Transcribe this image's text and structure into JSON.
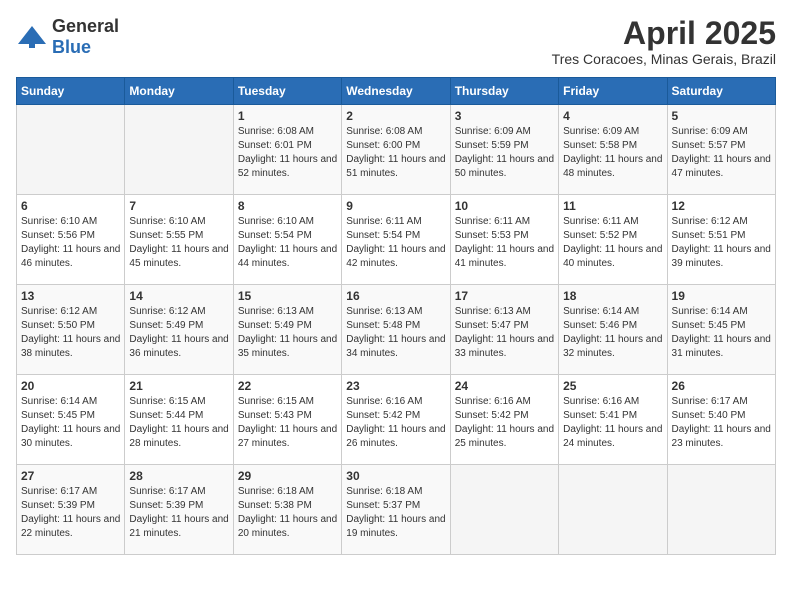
{
  "header": {
    "logo_general": "General",
    "logo_blue": "Blue",
    "title": "April 2025",
    "subtitle": "Tres Coracoes, Minas Gerais, Brazil"
  },
  "calendar": {
    "weekdays": [
      "Sunday",
      "Monday",
      "Tuesday",
      "Wednesday",
      "Thursday",
      "Friday",
      "Saturday"
    ],
    "weeks": [
      [
        {
          "day": "",
          "sunrise": "",
          "sunset": "",
          "daylight": ""
        },
        {
          "day": "",
          "sunrise": "",
          "sunset": "",
          "daylight": ""
        },
        {
          "day": "1",
          "sunrise": "Sunrise: 6:08 AM",
          "sunset": "Sunset: 6:01 PM",
          "daylight": "Daylight: 11 hours and 52 minutes."
        },
        {
          "day": "2",
          "sunrise": "Sunrise: 6:08 AM",
          "sunset": "Sunset: 6:00 PM",
          "daylight": "Daylight: 11 hours and 51 minutes."
        },
        {
          "day": "3",
          "sunrise": "Sunrise: 6:09 AM",
          "sunset": "Sunset: 5:59 PM",
          "daylight": "Daylight: 11 hours and 50 minutes."
        },
        {
          "day": "4",
          "sunrise": "Sunrise: 6:09 AM",
          "sunset": "Sunset: 5:58 PM",
          "daylight": "Daylight: 11 hours and 48 minutes."
        },
        {
          "day": "5",
          "sunrise": "Sunrise: 6:09 AM",
          "sunset": "Sunset: 5:57 PM",
          "daylight": "Daylight: 11 hours and 47 minutes."
        }
      ],
      [
        {
          "day": "6",
          "sunrise": "Sunrise: 6:10 AM",
          "sunset": "Sunset: 5:56 PM",
          "daylight": "Daylight: 11 hours and 46 minutes."
        },
        {
          "day": "7",
          "sunrise": "Sunrise: 6:10 AM",
          "sunset": "Sunset: 5:55 PM",
          "daylight": "Daylight: 11 hours and 45 minutes."
        },
        {
          "day": "8",
          "sunrise": "Sunrise: 6:10 AM",
          "sunset": "Sunset: 5:54 PM",
          "daylight": "Daylight: 11 hours and 44 minutes."
        },
        {
          "day": "9",
          "sunrise": "Sunrise: 6:11 AM",
          "sunset": "Sunset: 5:54 PM",
          "daylight": "Daylight: 11 hours and 42 minutes."
        },
        {
          "day": "10",
          "sunrise": "Sunrise: 6:11 AM",
          "sunset": "Sunset: 5:53 PM",
          "daylight": "Daylight: 11 hours and 41 minutes."
        },
        {
          "day": "11",
          "sunrise": "Sunrise: 6:11 AM",
          "sunset": "Sunset: 5:52 PM",
          "daylight": "Daylight: 11 hours and 40 minutes."
        },
        {
          "day": "12",
          "sunrise": "Sunrise: 6:12 AM",
          "sunset": "Sunset: 5:51 PM",
          "daylight": "Daylight: 11 hours and 39 minutes."
        }
      ],
      [
        {
          "day": "13",
          "sunrise": "Sunrise: 6:12 AM",
          "sunset": "Sunset: 5:50 PM",
          "daylight": "Daylight: 11 hours and 38 minutes."
        },
        {
          "day": "14",
          "sunrise": "Sunrise: 6:12 AM",
          "sunset": "Sunset: 5:49 PM",
          "daylight": "Daylight: 11 hours and 36 minutes."
        },
        {
          "day": "15",
          "sunrise": "Sunrise: 6:13 AM",
          "sunset": "Sunset: 5:49 PM",
          "daylight": "Daylight: 11 hours and 35 minutes."
        },
        {
          "day": "16",
          "sunrise": "Sunrise: 6:13 AM",
          "sunset": "Sunset: 5:48 PM",
          "daylight": "Daylight: 11 hours and 34 minutes."
        },
        {
          "day": "17",
          "sunrise": "Sunrise: 6:13 AM",
          "sunset": "Sunset: 5:47 PM",
          "daylight": "Daylight: 11 hours and 33 minutes."
        },
        {
          "day": "18",
          "sunrise": "Sunrise: 6:14 AM",
          "sunset": "Sunset: 5:46 PM",
          "daylight": "Daylight: 11 hours and 32 minutes."
        },
        {
          "day": "19",
          "sunrise": "Sunrise: 6:14 AM",
          "sunset": "Sunset: 5:45 PM",
          "daylight": "Daylight: 11 hours and 31 minutes."
        }
      ],
      [
        {
          "day": "20",
          "sunrise": "Sunrise: 6:14 AM",
          "sunset": "Sunset: 5:45 PM",
          "daylight": "Daylight: 11 hours and 30 minutes."
        },
        {
          "day": "21",
          "sunrise": "Sunrise: 6:15 AM",
          "sunset": "Sunset: 5:44 PM",
          "daylight": "Daylight: 11 hours and 28 minutes."
        },
        {
          "day": "22",
          "sunrise": "Sunrise: 6:15 AM",
          "sunset": "Sunset: 5:43 PM",
          "daylight": "Daylight: 11 hours and 27 minutes."
        },
        {
          "day": "23",
          "sunrise": "Sunrise: 6:16 AM",
          "sunset": "Sunset: 5:42 PM",
          "daylight": "Daylight: 11 hours and 26 minutes."
        },
        {
          "day": "24",
          "sunrise": "Sunrise: 6:16 AM",
          "sunset": "Sunset: 5:42 PM",
          "daylight": "Daylight: 11 hours and 25 minutes."
        },
        {
          "day": "25",
          "sunrise": "Sunrise: 6:16 AM",
          "sunset": "Sunset: 5:41 PM",
          "daylight": "Daylight: 11 hours and 24 minutes."
        },
        {
          "day": "26",
          "sunrise": "Sunrise: 6:17 AM",
          "sunset": "Sunset: 5:40 PM",
          "daylight": "Daylight: 11 hours and 23 minutes."
        }
      ],
      [
        {
          "day": "27",
          "sunrise": "Sunrise: 6:17 AM",
          "sunset": "Sunset: 5:39 PM",
          "daylight": "Daylight: 11 hours and 22 minutes."
        },
        {
          "day": "28",
          "sunrise": "Sunrise: 6:17 AM",
          "sunset": "Sunset: 5:39 PM",
          "daylight": "Daylight: 11 hours and 21 minutes."
        },
        {
          "day": "29",
          "sunrise": "Sunrise: 6:18 AM",
          "sunset": "Sunset: 5:38 PM",
          "daylight": "Daylight: 11 hours and 20 minutes."
        },
        {
          "day": "30",
          "sunrise": "Sunrise: 6:18 AM",
          "sunset": "Sunset: 5:37 PM",
          "daylight": "Daylight: 11 hours and 19 minutes."
        },
        {
          "day": "",
          "sunrise": "",
          "sunset": "",
          "daylight": ""
        },
        {
          "day": "",
          "sunrise": "",
          "sunset": "",
          "daylight": ""
        },
        {
          "day": "",
          "sunrise": "",
          "sunset": "",
          "daylight": ""
        }
      ]
    ]
  }
}
